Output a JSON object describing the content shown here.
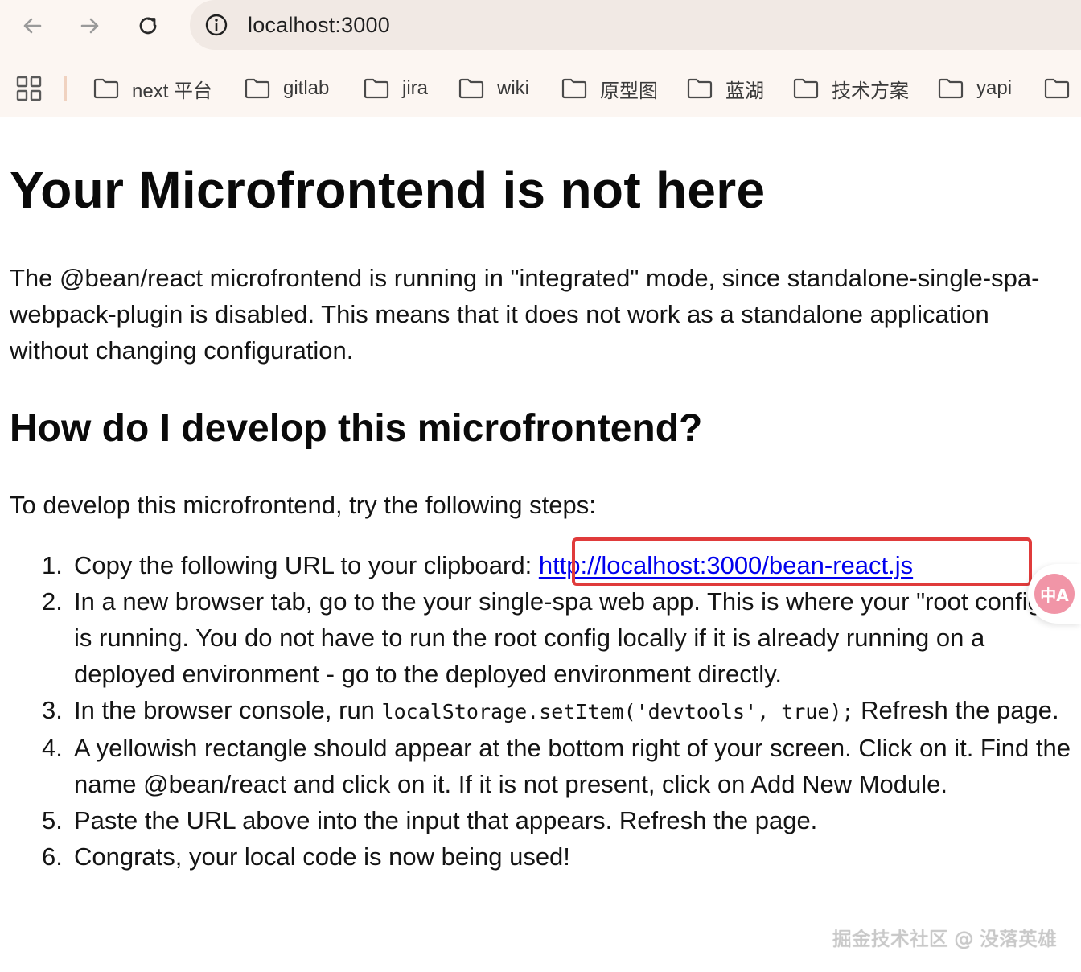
{
  "browser": {
    "address_bar": {
      "url": "localhost:3000"
    },
    "bookmarks": [
      {
        "label": "next 平台",
        "icon": "folder-icon"
      },
      {
        "label": "gitlab",
        "icon": "folder-icon"
      },
      {
        "label": "jira",
        "icon": "folder-icon"
      },
      {
        "label": "wiki",
        "icon": "folder-icon"
      },
      {
        "label": "原型图",
        "icon": "folder-icon"
      },
      {
        "label": "蓝湖",
        "icon": "folder-icon"
      },
      {
        "label": "技术方案",
        "icon": "folder-icon"
      },
      {
        "label": "yapi",
        "icon": "folder-icon"
      }
    ]
  },
  "page": {
    "title": "Your Microfrontend is not here",
    "intro": "The @bean/react microfrontend is running in \"integrated\" mode, since standalone-single-spa-webpack-plugin is disabled. This means that it does not work as a standalone application without changing configuration.",
    "subtitle": "How do I develop this microfrontend?",
    "steps_intro": "To develop this microfrontend, try the following steps:",
    "steps": [
      {
        "num": "1.",
        "text": "Copy the following URL to your clipboard: ",
        "link": "http://localhost:3000/bean-react.js"
      },
      {
        "num": "2.",
        "text": "In a new browser tab, go to the your single-spa web app. This is where your \"root config\" is running. You do not have to run the root config locally if it is already running on a deployed environment - go to the deployed environment directly."
      },
      {
        "num": "3.",
        "text_before": "In the browser console, run ",
        "code": "localStorage.setItem('devtools', true);",
        "text_after": " Refresh the page."
      },
      {
        "num": "4.",
        "text": "A yellowish rectangle should appear at the bottom right of your screen. Click on it. Find the name @bean/react and click on it. If it is not present, click on Add New Module."
      },
      {
        "num": "5.",
        "text": "Paste the URL above into the input that appears. Refresh the page."
      },
      {
        "num": "6.",
        "text": "Congrats, your local code is now being used!"
      }
    ]
  },
  "overlay": {
    "translate_badge": "中A",
    "watermark": "掘金技术社区 @ 没落英雄"
  },
  "colors": {
    "highlight_border": "#e03b3b",
    "link": "#0000ee",
    "chrome_background": "#fcf6f2"
  }
}
